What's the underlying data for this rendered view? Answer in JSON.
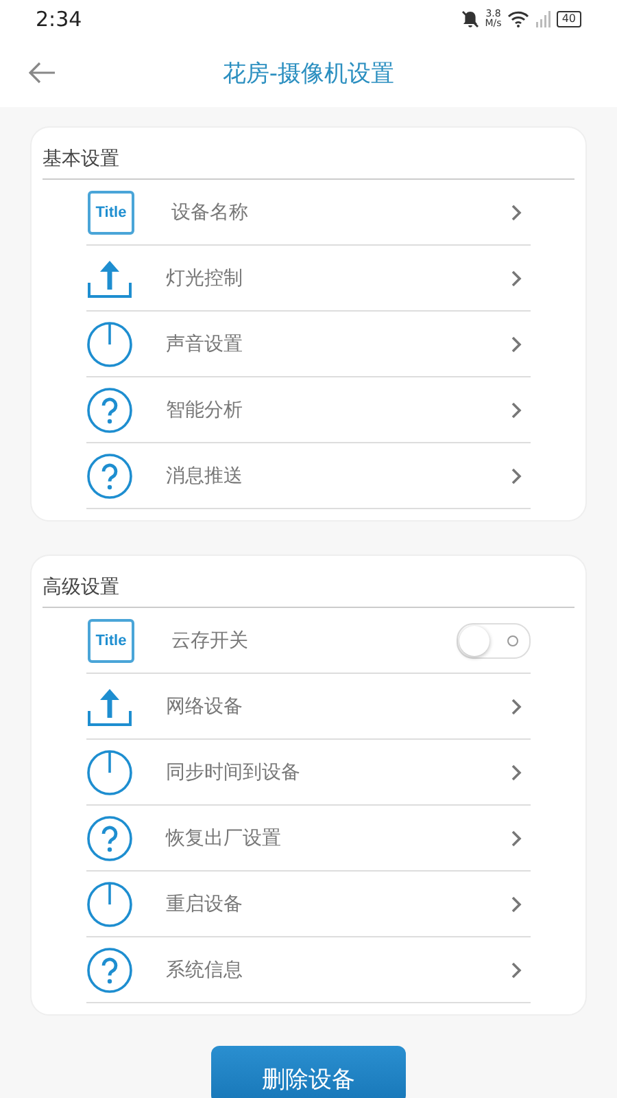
{
  "status_bar": {
    "time": "2:34",
    "speed_value": "3.8",
    "speed_unit": "M/s",
    "battery": "40"
  },
  "header": {
    "title": "花房-摄像机设置"
  },
  "sections": [
    {
      "title": "基本设置",
      "rows": [
        {
          "kind": "link",
          "icon": {
            "kind": "title",
            "text": "Title"
          },
          "label": "设备名称"
        },
        {
          "kind": "link",
          "icon": {
            "kind": "upload"
          },
          "label": "灯光控制"
        },
        {
          "kind": "link",
          "icon": {
            "kind": "power"
          },
          "label": "声音设置"
        },
        {
          "kind": "link",
          "icon": {
            "kind": "question"
          },
          "label": "智能分析"
        },
        {
          "kind": "link",
          "icon": {
            "kind": "question"
          },
          "label": "消息推送"
        }
      ]
    },
    {
      "title": "高级设置",
      "rows": [
        {
          "kind": "toggle",
          "icon": {
            "kind": "title",
            "text": "Title"
          },
          "label": "云存开关",
          "on": false
        },
        {
          "kind": "link",
          "icon": {
            "kind": "upload"
          },
          "label": "网络设备"
        },
        {
          "kind": "link",
          "icon": {
            "kind": "power"
          },
          "label": "同步时间到设备"
        },
        {
          "kind": "link",
          "icon": {
            "kind": "question"
          },
          "label": "恢复出厂设置"
        },
        {
          "kind": "link",
          "icon": {
            "kind": "power"
          },
          "label": "重启设备"
        },
        {
          "kind": "link",
          "icon": {
            "kind": "question"
          },
          "label": "系统信息"
        }
      ]
    }
  ],
  "delete_button": "删除设备"
}
